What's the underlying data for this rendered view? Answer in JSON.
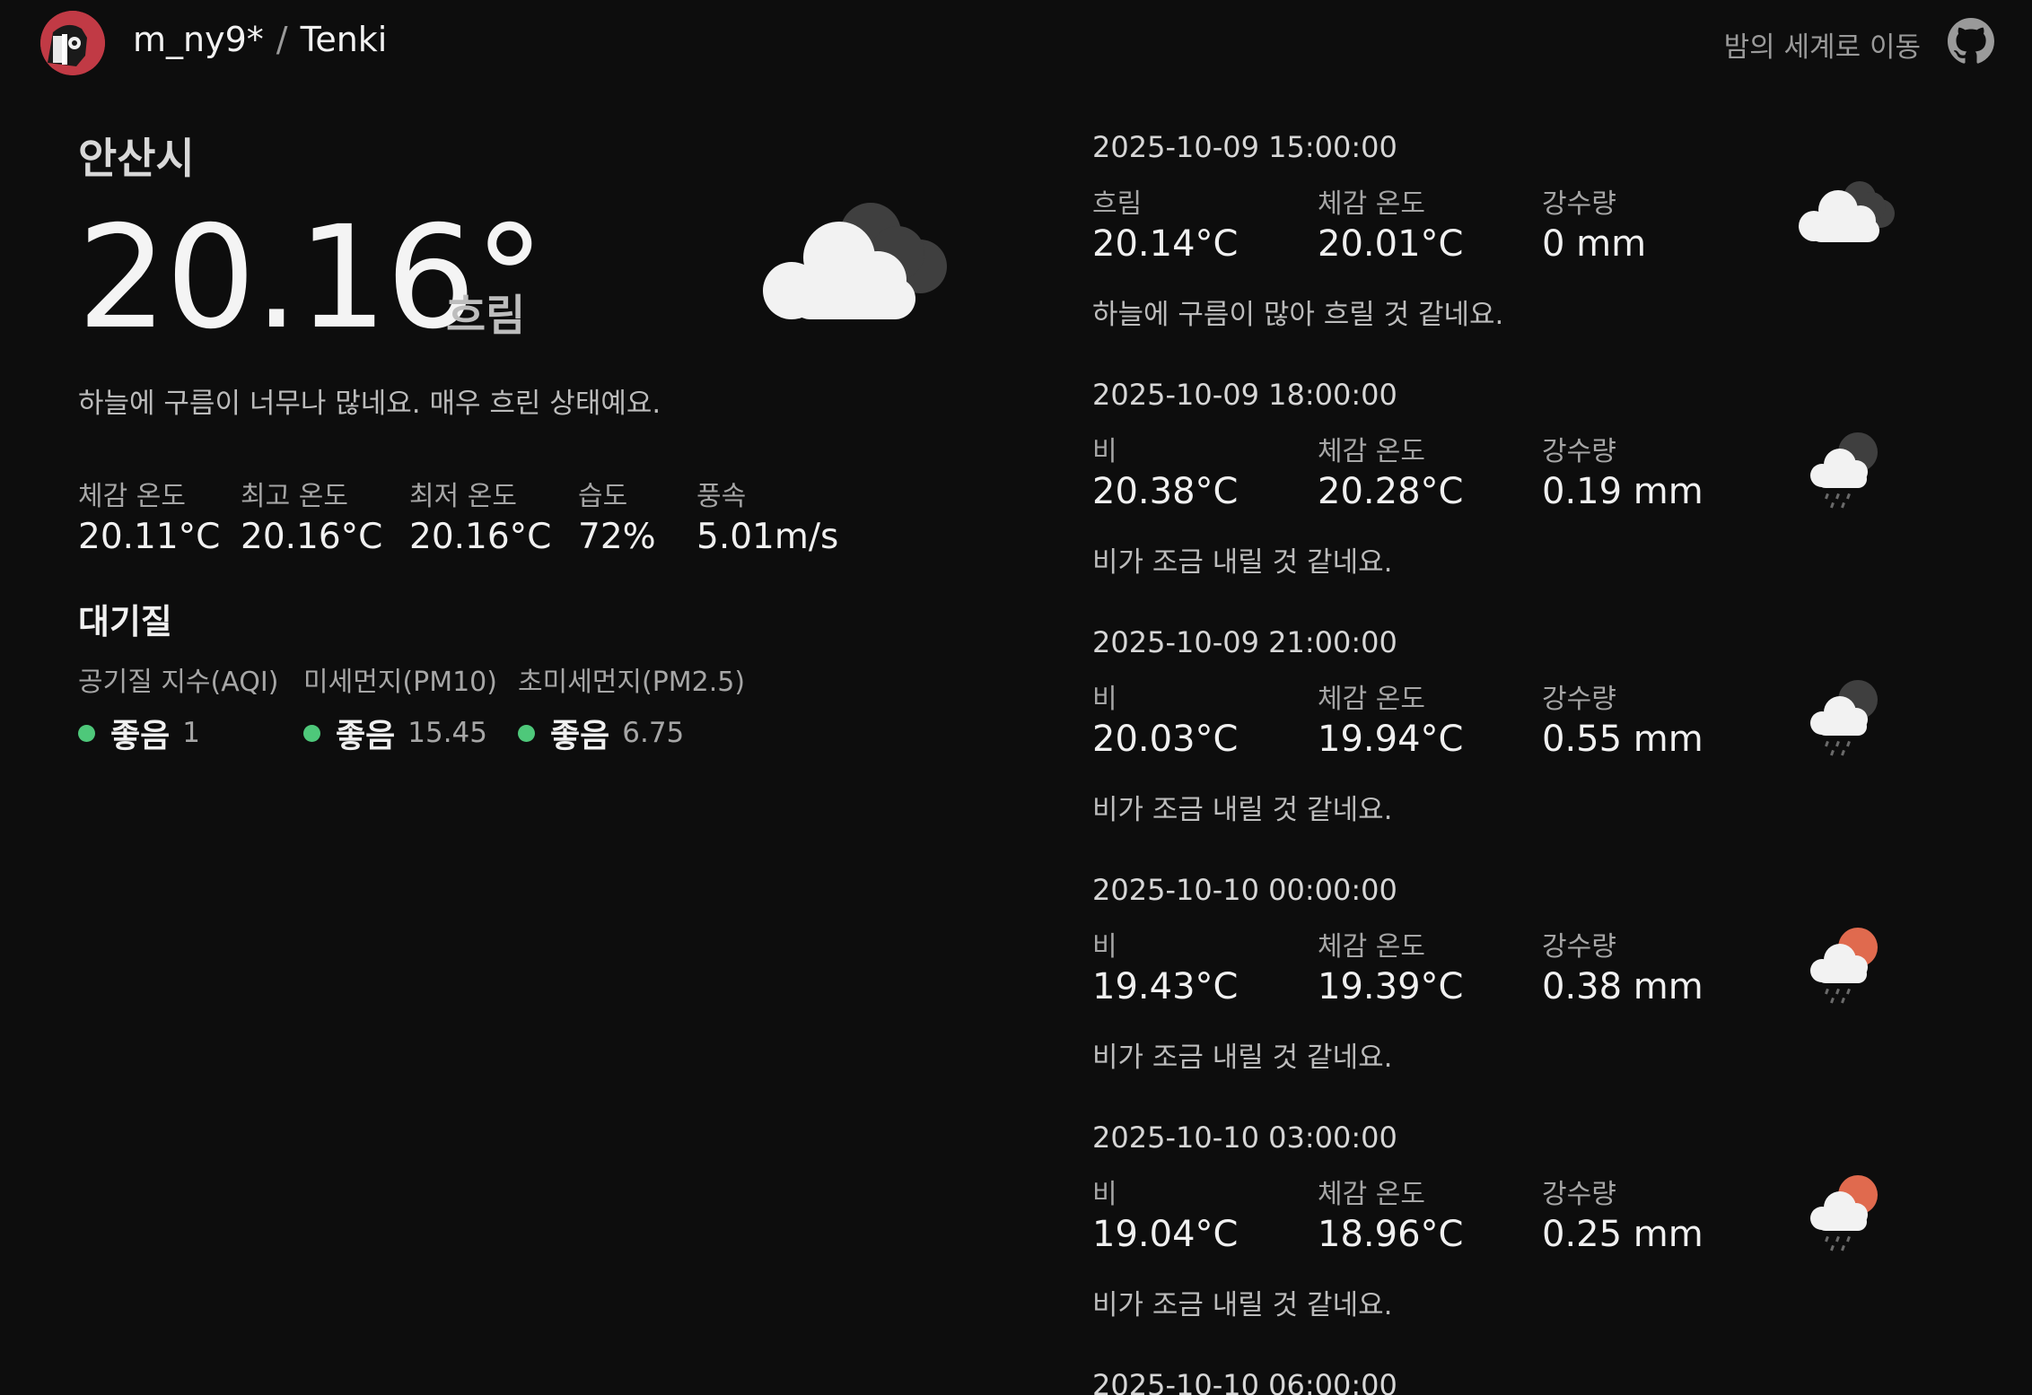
{
  "header": {
    "user": "m_ny9*",
    "separator": "/",
    "app": "Tenki",
    "night_link": "밤의 세계로 이동"
  },
  "current": {
    "city": "안산시",
    "temp": "20.16°",
    "condition": "흐림",
    "description": "하늘에 구름이 너무나 많네요. 매우 흐린 상태예요.",
    "icon": "cloudy-icon",
    "stats": [
      {
        "label": "체감 온도",
        "value": "20.11°C"
      },
      {
        "label": "최고 온도",
        "value": "20.16°C"
      },
      {
        "label": "최저 온도",
        "value": "20.16°C"
      },
      {
        "label": "습도",
        "value": "72%"
      },
      {
        "label": "풍속",
        "value": "5.01m/s"
      }
    ]
  },
  "air_quality": {
    "title": "대기질",
    "status_color": "#4ec87a",
    "items": [
      {
        "label": "공기질 지수(AQI)",
        "grade": "좋음",
        "value": "1"
      },
      {
        "label": "미세먼지(PM10)",
        "grade": "좋음",
        "value": "15.45"
      },
      {
        "label": "초미세먼지(PM2.5)",
        "grade": "좋음",
        "value": "6.75"
      }
    ]
  },
  "forecast": {
    "feels_label": "체감 온도",
    "precip_label": "강수량",
    "items": [
      {
        "datetime": "2025-10-09 15:00:00",
        "condition": "흐림",
        "temp": "20.14°C",
        "feels": "20.01°C",
        "precip": "0 mm",
        "description": "하늘에 구름이 많아 흐릴 것 같네요.",
        "icon": "cloudy-icon"
      },
      {
        "datetime": "2025-10-09 18:00:00",
        "condition": "비",
        "temp": "20.38°C",
        "feels": "20.28°C",
        "precip": "0.19 mm",
        "description": "비가 조금 내릴 것 같네요.",
        "icon": "rain-night-icon"
      },
      {
        "datetime": "2025-10-09 21:00:00",
        "condition": "비",
        "temp": "20.03°C",
        "feels": "19.94°C",
        "precip": "0.55 mm",
        "description": "비가 조금 내릴 것 같네요.",
        "icon": "rain-night-icon"
      },
      {
        "datetime": "2025-10-10 00:00:00",
        "condition": "비",
        "temp": "19.43°C",
        "feels": "19.39°C",
        "precip": "0.38 mm",
        "description": "비가 조금 내릴 것 같네요.",
        "icon": "rain-sun-icon"
      },
      {
        "datetime": "2025-10-10 03:00:00",
        "condition": "비",
        "temp": "19.04°C",
        "feels": "18.96°C",
        "precip": "0.25 mm",
        "description": "비가 조금 내릴 것 같네요.",
        "icon": "rain-sun-icon"
      },
      {
        "datetime": "2025-10-10 06:00:00"
      }
    ]
  }
}
